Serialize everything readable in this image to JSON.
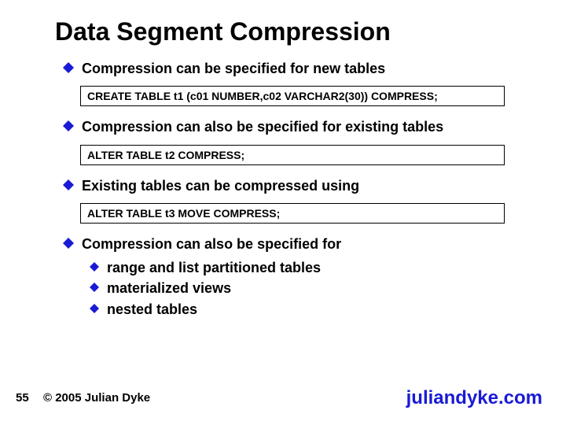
{
  "title": "Data Segment Compression",
  "bullets": {
    "b1": "Compression can be specified for new tables",
    "b2": "Compression can also be specified for existing tables",
    "b3": "Existing tables can be compressed using",
    "b4": "Compression can also be specified for",
    "s1": "range and list partitioned tables",
    "s2": "materialized views",
    "s3": "nested tables"
  },
  "code": {
    "c1": "CREATE TABLE t1 (c01 NUMBER,c02 VARCHAR2(30)) COMPRESS;",
    "c2": "ALTER TABLE t2 COMPRESS;",
    "c3": "ALTER TABLE t3 MOVE COMPRESS;"
  },
  "footer": {
    "page": "55",
    "copyright": "© 2005 Julian Dyke",
    "brand": "juliandyke.com"
  },
  "colors": {
    "bullet": "#1a1ad6"
  }
}
